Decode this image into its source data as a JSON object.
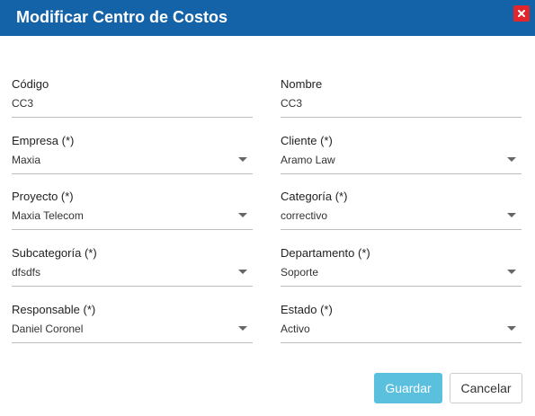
{
  "dialog": {
    "title": "Modificar Centro de Costos"
  },
  "form": {
    "codigo": {
      "label": "Código",
      "value": "CC3"
    },
    "nombre": {
      "label": "Nombre",
      "value": "CC3"
    },
    "empresa": {
      "label": "Empresa (*)",
      "value": "Maxia"
    },
    "cliente": {
      "label": "Cliente (*)",
      "value": "Aramo Law"
    },
    "proyecto": {
      "label": "Proyecto (*)",
      "value": "Maxia Telecom"
    },
    "categoria": {
      "label": "Categoría (*)",
      "value": "correctivo"
    },
    "subcategoria": {
      "label": "Subcategoría (*)",
      "value": "dfsdfs"
    },
    "departamento": {
      "label": "Departamento (*)",
      "value": "Soporte"
    },
    "responsable": {
      "label": "Responsable (*)",
      "value": "Daniel Coronel"
    },
    "estado": {
      "label": "Estado (*)",
      "value": "Activo"
    }
  },
  "actions": {
    "save_label": "Guardar",
    "cancel_label": "Cancelar"
  },
  "colors": {
    "header": "#1462a7",
    "close": "#e3262c",
    "save": "#5bc0de"
  },
  "icons": {
    "close": "close-icon",
    "dropdown": "chevron-down-icon"
  }
}
